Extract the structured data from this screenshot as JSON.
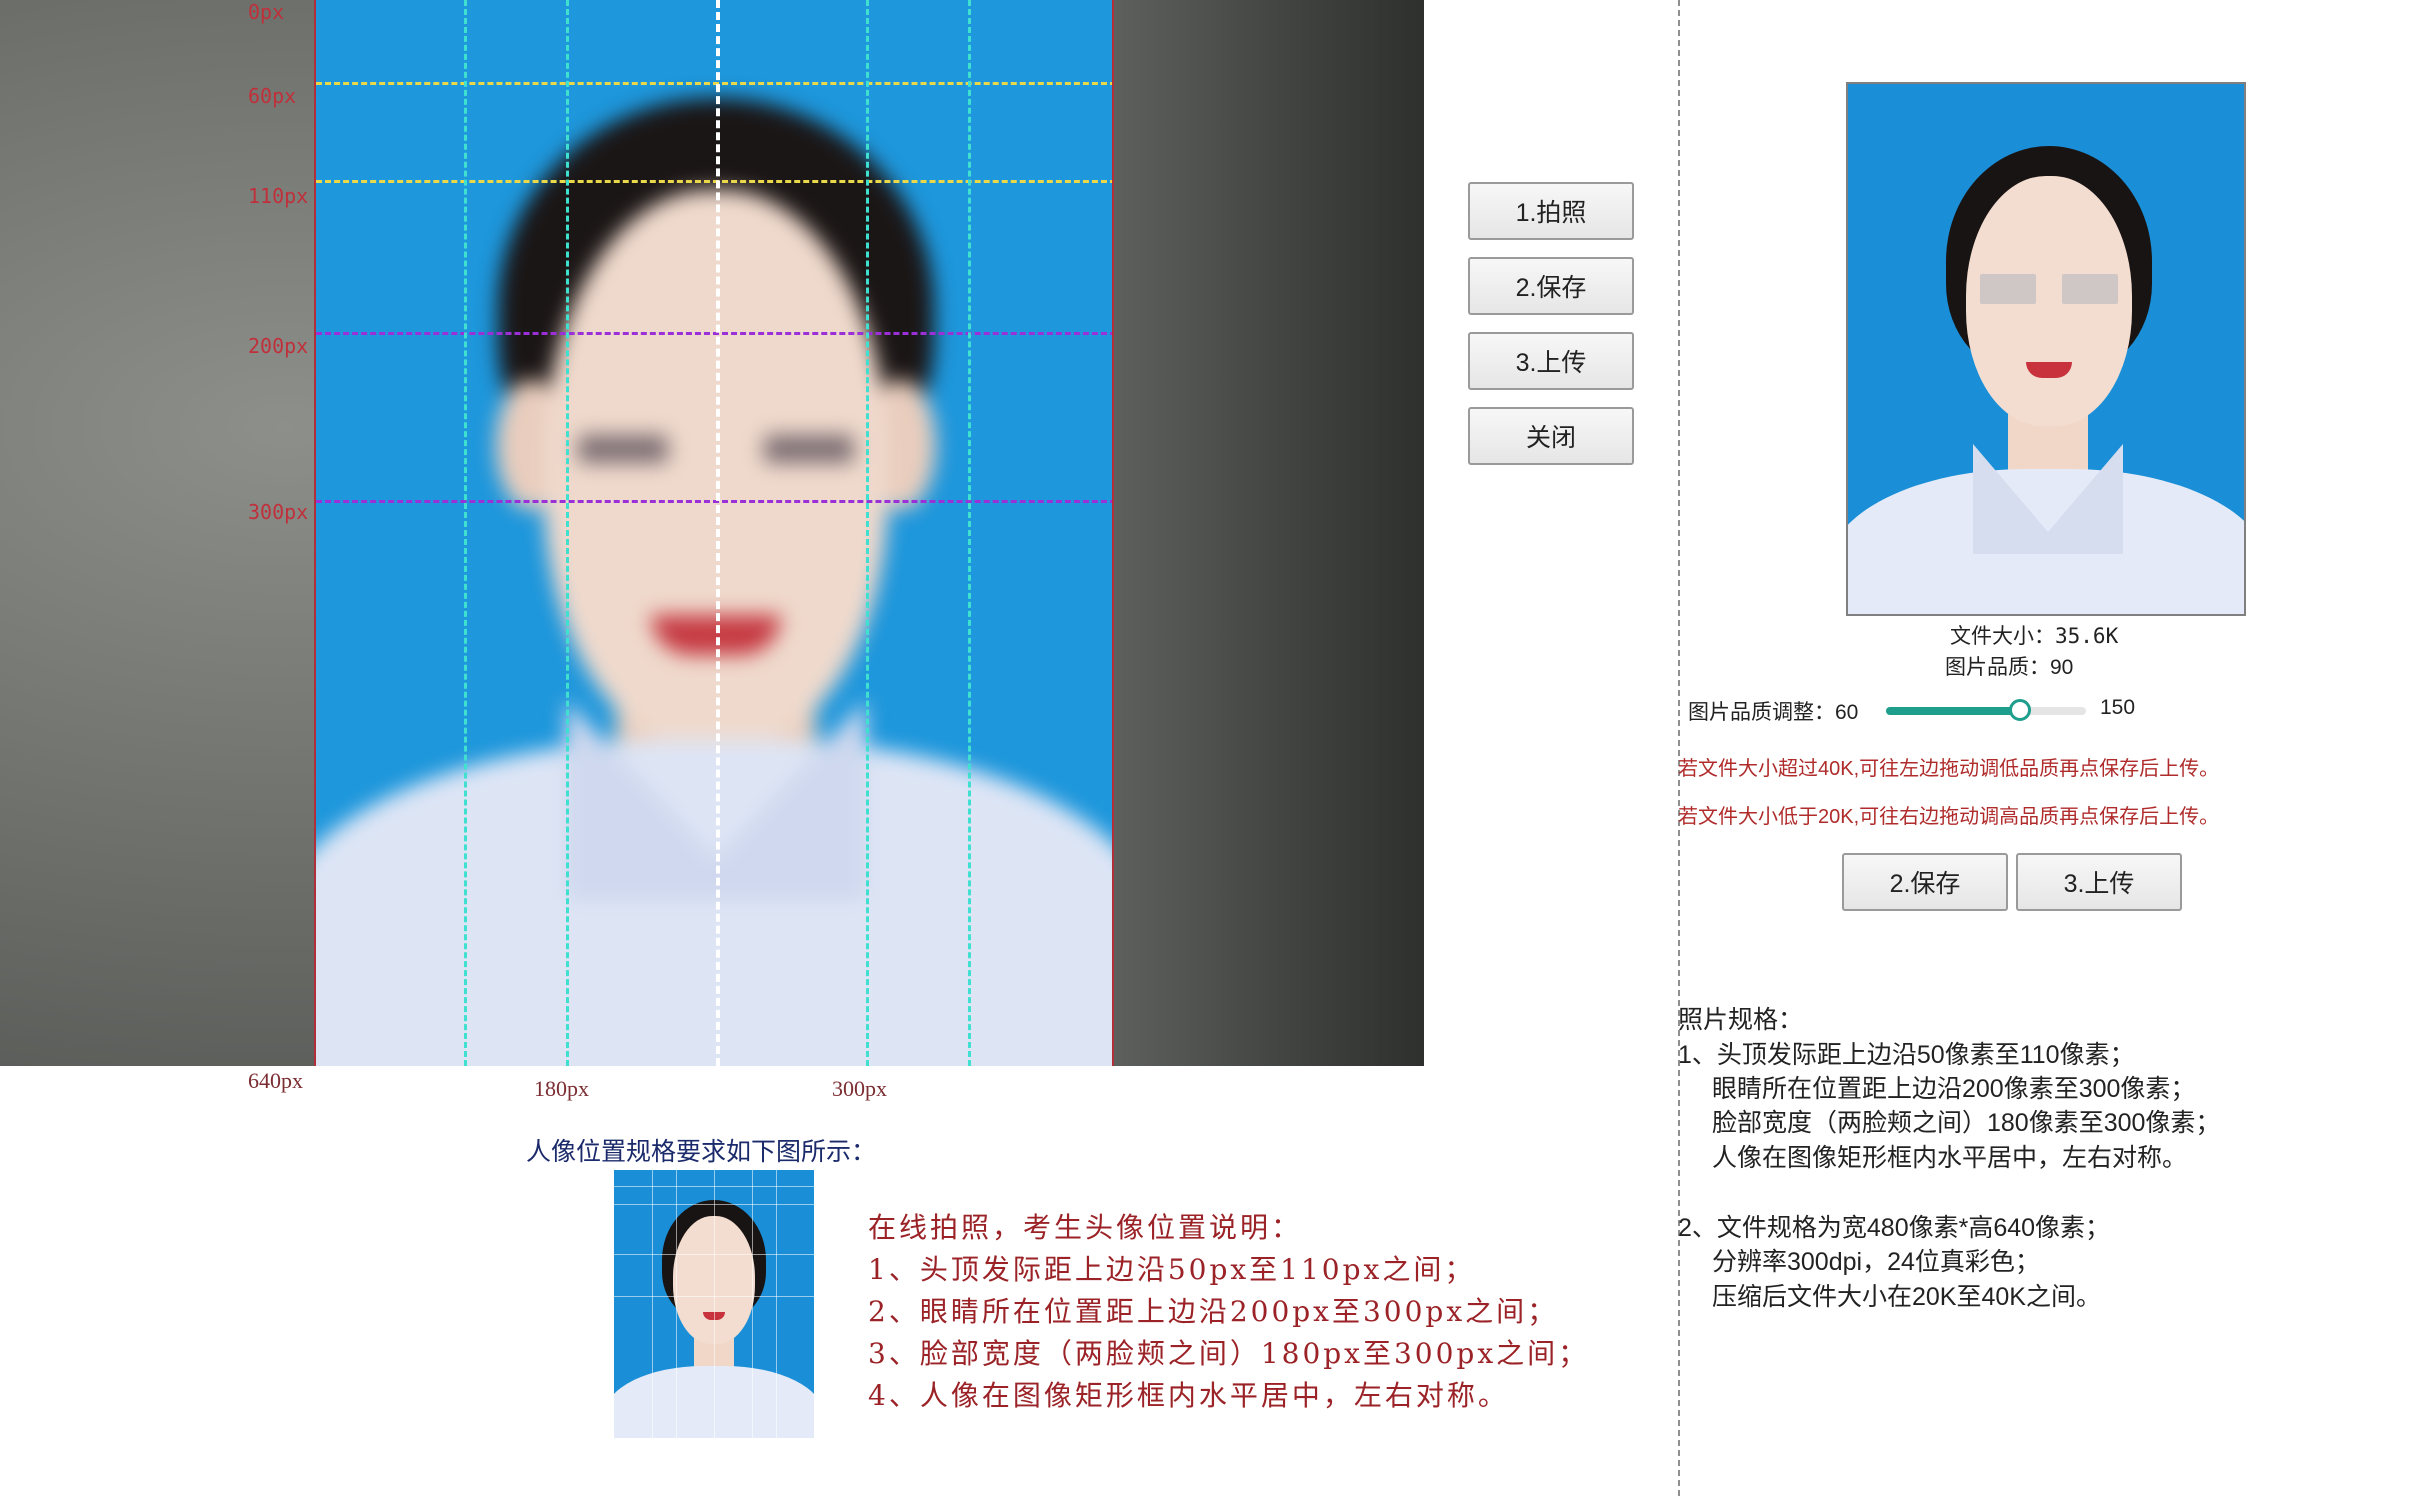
{
  "camera": {
    "ticks": [
      "0px",
      "60px",
      "110px",
      "200px",
      "300px",
      "640px"
    ],
    "x_ticks": [
      "180px",
      "300px"
    ]
  },
  "buttons": {
    "take_photo": "1.拍照",
    "save": "2.保存",
    "upload": "3.上传",
    "close": "关闭"
  },
  "result": {
    "file_size_label": "文件大小：",
    "file_size_value": "35.6K",
    "quality_label": "图片品质：90",
    "quality_adjust_label": "图片品质调整：60",
    "quality_max": "150",
    "quality_level_fraction": 0.67,
    "warning_over": "若文件大小超过40K,可往左边拖动调低品质再点保存后上传。",
    "warning_under": "若文件大小低于20K,可往右边拖动调高品质再点保存后上传。",
    "save_label": "2.保存",
    "upload_label": "3.上传"
  },
  "spec": {
    "title": "照片规格：",
    "lines": [
      "1、头顶发际距上边沿50像素至110像素；",
      "眼睛所在位置距上边沿200像素至300像素；",
      "脸部宽度（两脸颊之间）180像素至300像素；",
      "人像在图像矩形框内水平居中，左右对称。",
      "2、文件规格为宽480像素*高640像素；",
      "分辨率300dpi，24位真彩色；",
      "压缩后文件大小在20K至40K之间。"
    ]
  },
  "guide": {
    "heading": "人像位置规格要求如下图所示：",
    "notes": [
      "在线拍照，考生头像位置说明：",
      "1、头顶发际距上边沿50px至110px之间；",
      "2、眼睛所在位置距上边沿200px至300px之间；",
      "3、脸部宽度（两脸颊之间）180px至300px之间；",
      "4、人像在图像矩形框内水平居中，左右对称。"
    ]
  },
  "colors": {
    "photo_background": "#1e97dc",
    "warning_text": "#b02b2b",
    "guide_notes": "#9b2226",
    "slider_accent": "#1e9e8c"
  }
}
